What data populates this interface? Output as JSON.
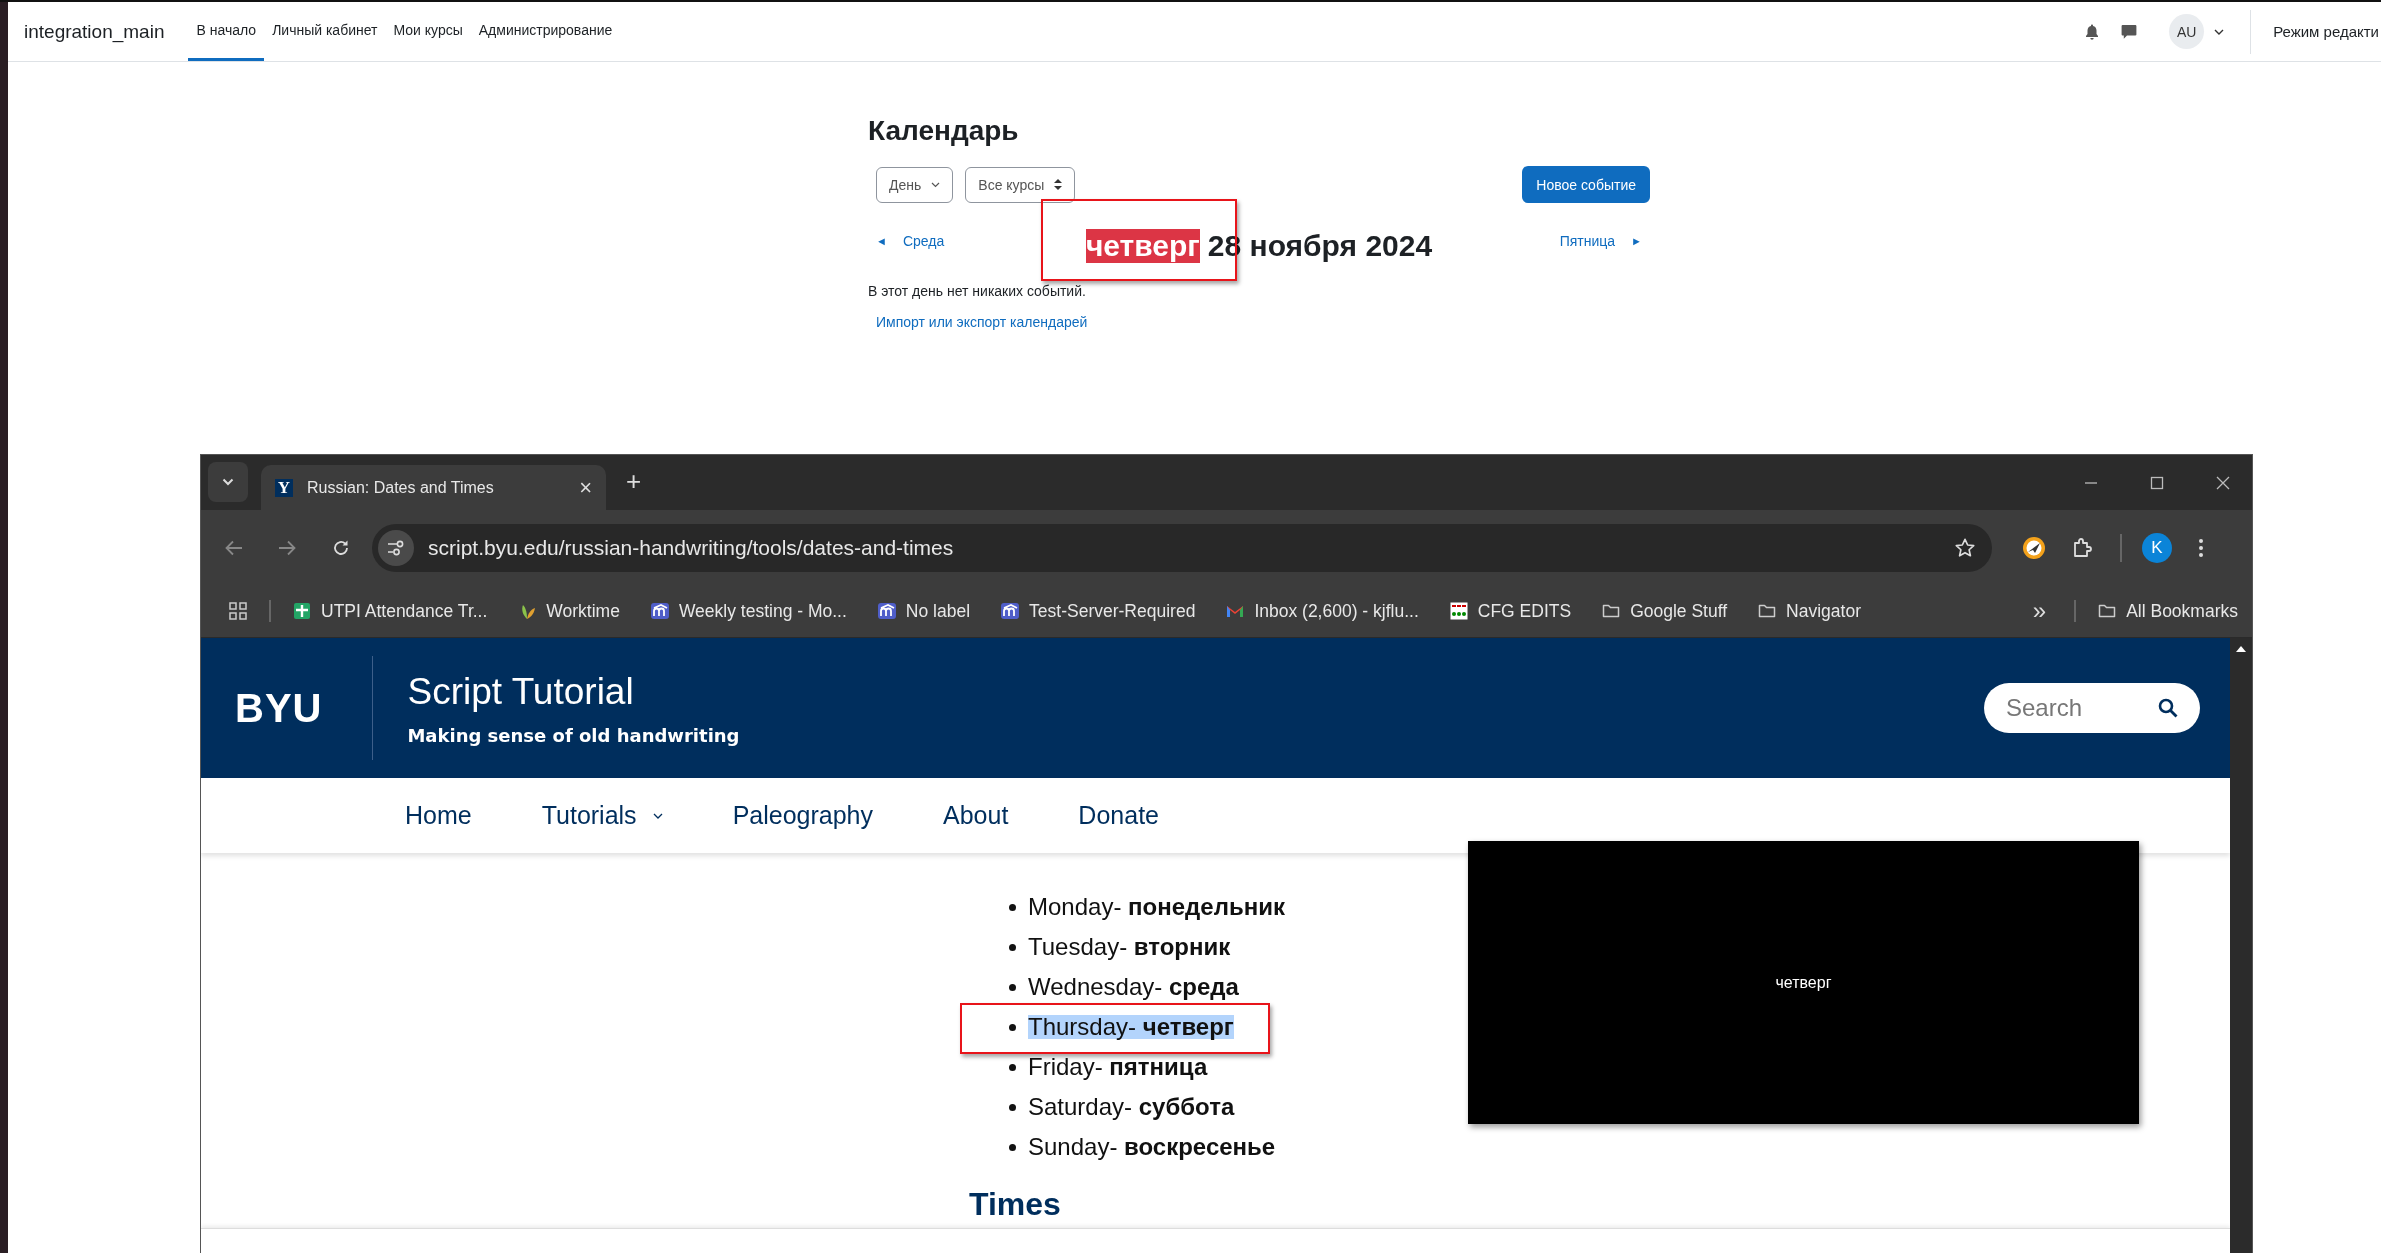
{
  "moodle": {
    "brand": "integration_main",
    "nav": [
      {
        "label": "В начало",
        "selected": true
      },
      {
        "label": "Личный кабинет",
        "selected": false
      },
      {
        "label": "Мои курсы",
        "selected": false
      },
      {
        "label": "Администрирование",
        "selected": false
      }
    ],
    "avatar": "AU",
    "edit_mode": "Режим редакти"
  },
  "calendar": {
    "title": "Календарь",
    "view_select": "День",
    "course_select": "Все курсы",
    "new_event": "Новое событие",
    "prev_arrow": "◄",
    "prev": "Среда",
    "day_name": "четверг",
    "day_name_highlighted": true,
    "date": "28 ноября 2024",
    "next": "Пятница",
    "next_arrow": "►",
    "empty": "В этот день нет никаких событий.",
    "import_link": "Импорт или экспорт календарей"
  },
  "browser": {
    "tab": {
      "favicon": "Y",
      "title": "Russian: Dates and Times",
      "close": "×"
    },
    "new_tab": "+",
    "url": "script.byu.edu/russian-handwriting/tools/dates-and-times",
    "profile": "K",
    "bookmarks": [
      {
        "label": "UTPI Attendance Tr...",
        "kind": "sheets"
      },
      {
        "label": "Worktime",
        "kind": "leaf"
      },
      {
        "label": "Weekly testing - Mo...",
        "kind": "moodle"
      },
      {
        "label": "No label",
        "kind": "moodle"
      },
      {
        "label": "Test-Server-Required",
        "kind": "moodle"
      },
      {
        "label": "Inbox (2,600) - kjflu...",
        "kind": "gmail"
      },
      {
        "label": "CFG EDITS",
        "kind": "grid"
      },
      {
        "label": "Google Stuff",
        "kind": "folder"
      },
      {
        "label": "Navigator",
        "kind": "folder"
      }
    ],
    "overflow": "»",
    "all_bookmarks": "All Bookmarks"
  },
  "site": {
    "logo": "BYU",
    "title": "Script Tutorial",
    "subtitle": "Making sense of old handwriting",
    "search": {
      "placeholder": "Search"
    },
    "nav": [
      {
        "label": "Home",
        "dropdown": false
      },
      {
        "label": "Tutorials",
        "dropdown": true
      },
      {
        "label": "Paleography",
        "dropdown": false
      },
      {
        "label": "About",
        "dropdown": false
      },
      {
        "label": "Donate",
        "dropdown": false
      }
    ],
    "days": [
      {
        "english": "Monday-",
        "russian": "понедельник",
        "highlighted": false
      },
      {
        "english": "Tuesday-",
        "russian": "вторник",
        "highlighted": false
      },
      {
        "english": "Wednesday-",
        "russian": "среда",
        "highlighted": false
      },
      {
        "english": "Thursday-",
        "russian": "четверг",
        "highlighted": true
      },
      {
        "english": "Friday-",
        "russian": "пятница",
        "highlighted": false
      },
      {
        "english": "Saturday-",
        "russian": "суббота",
        "highlighted": false
      },
      {
        "english": "Sunday-",
        "russian": "воскресенье",
        "highlighted": false
      }
    ],
    "video_caption": "четверг",
    "next_heading": "Times"
  }
}
